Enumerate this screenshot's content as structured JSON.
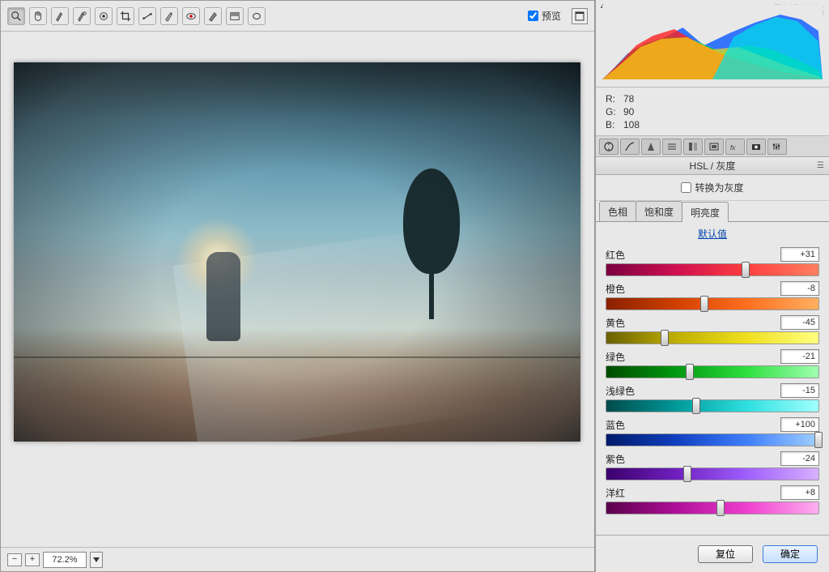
{
  "toolbar": {
    "preview_label": "预览",
    "preview_checked": true
  },
  "zoom": {
    "value": "72.2%"
  },
  "watermark": {
    "line1": "思缘设计论坛",
    "line2": "WWW.MISSYUAN.COM"
  },
  "rgb": {
    "r_label": "R:",
    "r_val": "78",
    "g_label": "G:",
    "g_val": "90",
    "b_label": "B:",
    "b_val": "108"
  },
  "section": {
    "title": "HSL / 灰度"
  },
  "convert": {
    "label": "转换为灰度",
    "checked": false
  },
  "subtabs": {
    "hue": "色相",
    "sat": "饱和度",
    "lum": "明亮度"
  },
  "defaults": {
    "label": "默认值"
  },
  "sliders": {
    "red": {
      "label": "红色",
      "value": "+31",
      "pos": 65.5
    },
    "orange": {
      "label": "橙色",
      "value": "-8",
      "pos": 46
    },
    "yellow": {
      "label": "黄色",
      "value": "-45",
      "pos": 27.5
    },
    "green": {
      "label": "绿色",
      "value": "-21",
      "pos": 39.5
    },
    "aqua": {
      "label": "浅绿色",
      "value": "-15",
      "pos": 42.5
    },
    "blue": {
      "label": "蓝色",
      "value": "+100",
      "pos": 100
    },
    "purple": {
      "label": "紫色",
      "value": "-24",
      "pos": 38
    },
    "magenta": {
      "label": "洋红",
      "value": "+8",
      "pos": 54
    }
  },
  "footer": {
    "reset": "复位",
    "ok": "确定"
  }
}
